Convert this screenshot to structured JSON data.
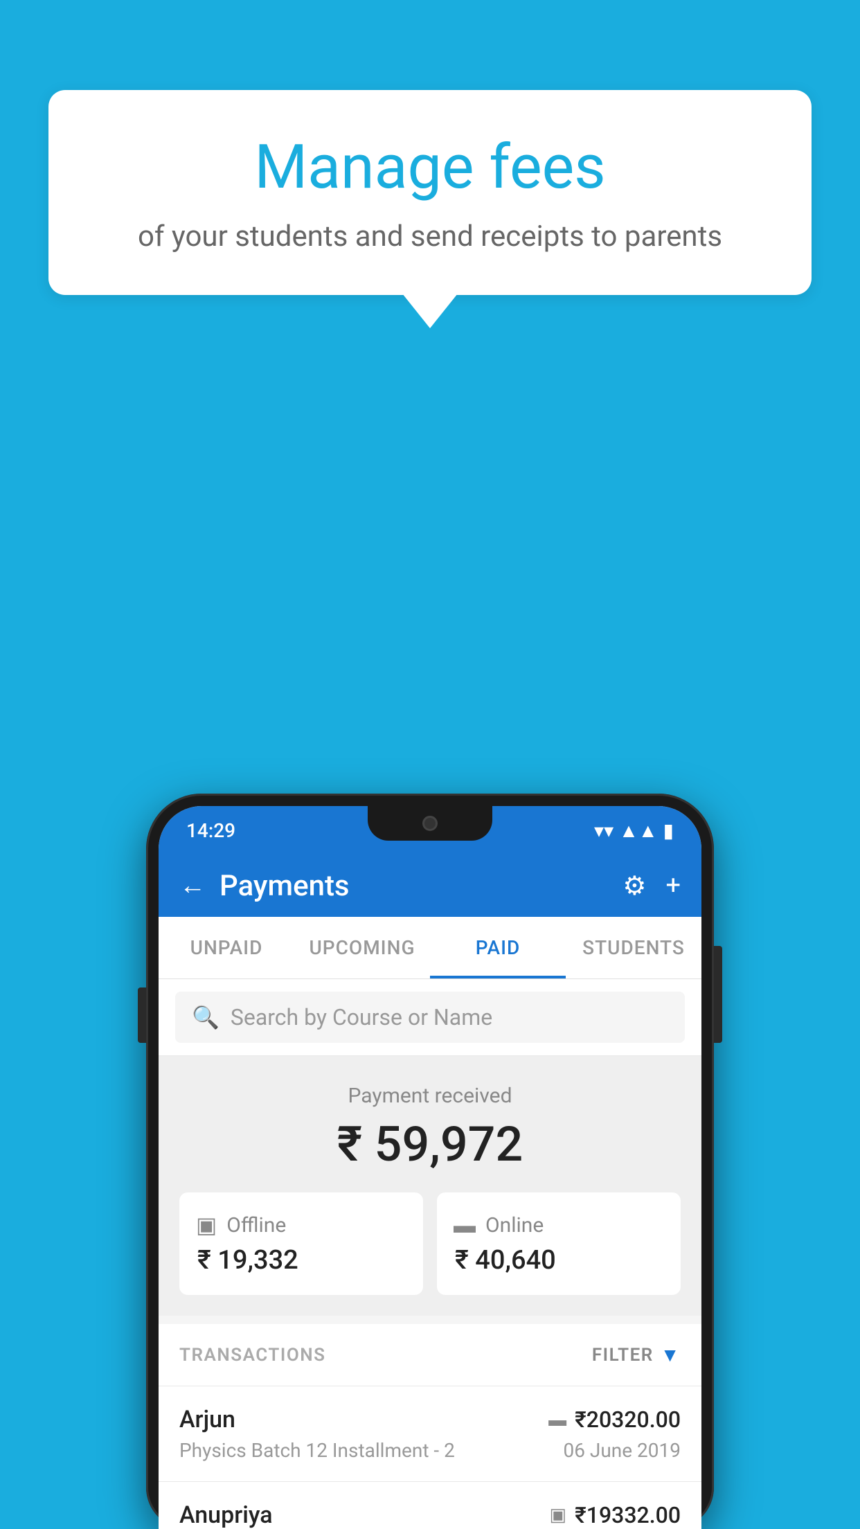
{
  "background_color": "#1AADDE",
  "speech_bubble": {
    "title": "Manage fees",
    "subtitle": "of your students and send receipts to parents"
  },
  "status_bar": {
    "time": "14:29",
    "wifi": "▼",
    "signal": "▲",
    "battery": "▮"
  },
  "header": {
    "title": "Payments",
    "back_label": "←",
    "settings_label": "⚙",
    "add_label": "+"
  },
  "tabs": [
    {
      "label": "UNPAID",
      "active": false
    },
    {
      "label": "UPCOMING",
      "active": false
    },
    {
      "label": "PAID",
      "active": true
    },
    {
      "label": "STUDENTS",
      "active": false
    }
  ],
  "search": {
    "placeholder": "Search by Course or Name"
  },
  "payment_summary": {
    "label": "Payment received",
    "total": "₹ 59,972",
    "offline": {
      "type": "Offline",
      "amount": "₹ 19,332"
    },
    "online": {
      "type": "Online",
      "amount": "₹ 40,640"
    }
  },
  "transactions": {
    "label": "TRANSACTIONS",
    "filter_label": "FILTER",
    "items": [
      {
        "name": "Arjun",
        "course": "Physics Batch 12 Installment - 2",
        "amount": "₹20320.00",
        "date": "06 June 2019",
        "payment_method": "card"
      },
      {
        "name": "Anupriya",
        "course": "",
        "amount": "₹19332.00",
        "date": "",
        "payment_method": "offline"
      }
    ]
  }
}
